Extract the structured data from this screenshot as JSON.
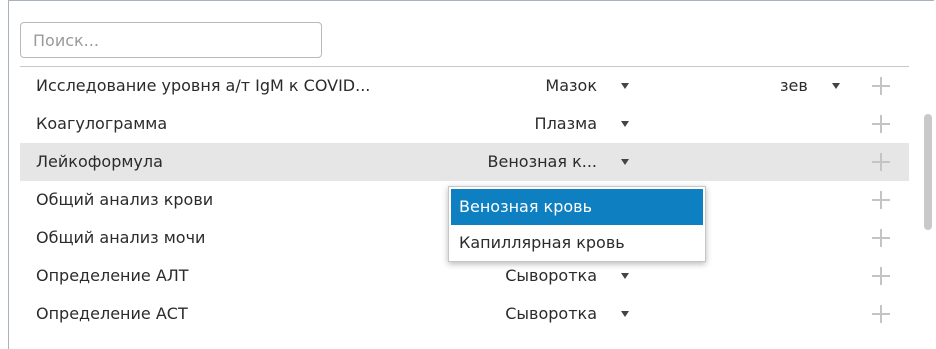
{
  "search": {
    "placeholder": "Поиск..."
  },
  "rows": [
    {
      "name": "Исследование уровня а/т IgM к COVID...",
      "material": "Мазок",
      "location": "зев"
    },
    {
      "name": "Коагулограмма",
      "material": "Плазма",
      "location": ""
    },
    {
      "name": "Лейкоформула",
      "material": "Венозная к...",
      "location": ""
    },
    {
      "name": "Общий анализ крови",
      "material": "",
      "location": ""
    },
    {
      "name": "Общий анализ мочи",
      "material": "",
      "location": ""
    },
    {
      "name": "Определение АЛТ",
      "material": "Сыворотка",
      "location": ""
    },
    {
      "name": "Определение АСТ",
      "material": "Сыворотка",
      "location": ""
    }
  ],
  "dropdown": {
    "options": [
      "Венозная кровь",
      "Капиллярная кровь"
    ],
    "selected_index": 0
  },
  "colors": {
    "selected_option_bg": "#0e7fc0",
    "highlight_row_bg": "#e6e6e6"
  }
}
